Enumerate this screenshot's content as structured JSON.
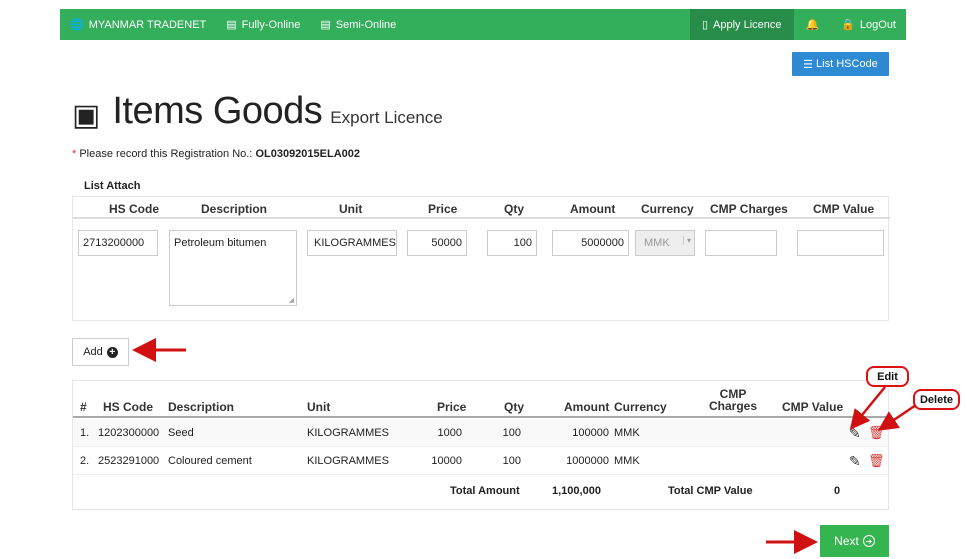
{
  "nav": {
    "brand": "MYANMAR TRADENET",
    "fully_online": "Fully-Online",
    "semi_online": "Semi-Online",
    "apply_licence": "Apply Licence",
    "logout": "LogOut"
  },
  "toolbar": {
    "list_hscode": "List HSCode"
  },
  "page": {
    "title": "Items Goods",
    "subtitle": "Export Licence",
    "reg_prefix": "Please record this Registration No.:",
    "reg_no": "OL03092015ELA002",
    "list_attach": "List Attach"
  },
  "entry": {
    "headers": [
      "HS Code",
      "Description",
      "Unit",
      "Price",
      "Qty",
      "Amount",
      "Currency",
      "CMP Charges",
      "CMP Value"
    ],
    "hs_code": "2713200000",
    "description": "Petroleum bitumen",
    "unit": "KILOGRAMMES",
    "price": "50000",
    "qty": "100",
    "amount": "5000000",
    "currency": "MMK",
    "cmp_charges": "",
    "cmp_value": ""
  },
  "add_button": {
    "label": "Add"
  },
  "items_table": {
    "headers": [
      "#",
      "HS Code",
      "Description",
      "Unit",
      "Price",
      "Qty",
      "Amount",
      "Currency",
      "CMP Charges",
      "CMP Value"
    ],
    "rows": [
      {
        "num": "1.",
        "hs_code": "1202300000",
        "description": "Seed",
        "unit": "KILOGRAMMES",
        "price": "1000",
        "qty": "100",
        "amount": "100000",
        "currency": "MMK"
      },
      {
        "num": "2.",
        "hs_code": "2523291000",
        "description": "Coloured cement",
        "unit": "KILOGRAMMES",
        "price": "10000",
        "qty": "100",
        "amount": "1000000",
        "currency": "MMK"
      }
    ],
    "total_amount_label": "Total Amount",
    "total_amount": "1,100,000",
    "total_cmp_label": "Total CMP Value",
    "total_cmp": "0"
  },
  "next_button": {
    "label": "Next"
  },
  "callouts": {
    "edit": "Edit",
    "delete": "Delete"
  },
  "colors": {
    "nav_green": "#33ae5b",
    "nav_active": "#278d49",
    "primary_blue": "#2f8ad4",
    "next_green": "#34b54f",
    "annotation_red": "#d11111"
  }
}
